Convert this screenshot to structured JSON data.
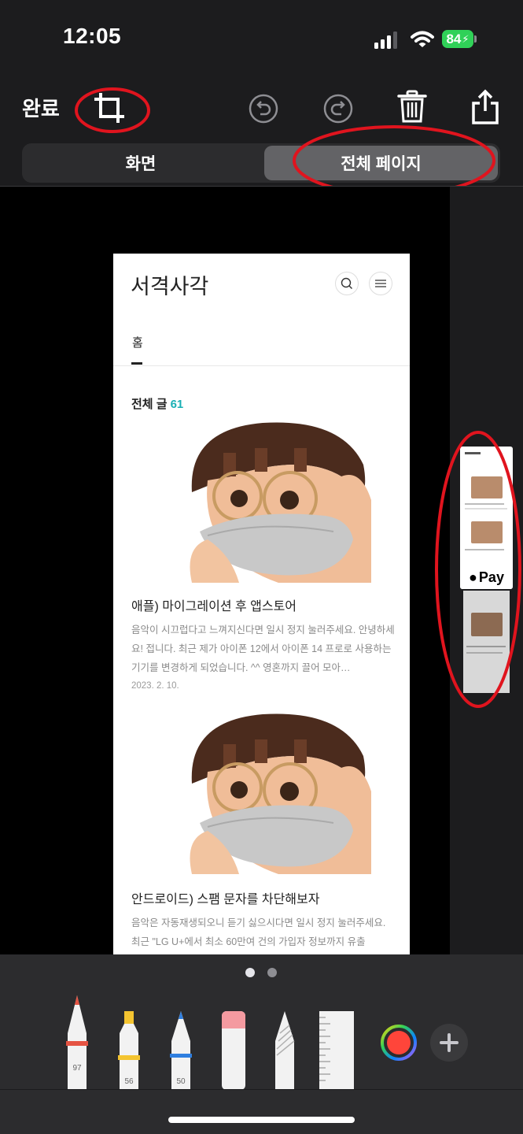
{
  "status_bar": {
    "time": "12:05",
    "battery": "84",
    "icons": [
      "cellular-signal-icon",
      "wifi-icon",
      "battery-charging-icon"
    ]
  },
  "toolbar": {
    "done_label": "완료",
    "icons": [
      "crop-icon",
      "undo-icon",
      "redo-icon",
      "trash-icon",
      "share-icon"
    ]
  },
  "segmented": {
    "screen_label": "화면",
    "full_page_label": "전체 페이지",
    "selected": "full_page"
  },
  "blog": {
    "title": "서격사각",
    "nav_home": "홈",
    "all_posts_label": "전체 글",
    "all_posts_count": "61",
    "posts": [
      {
        "title": "애플) 마이그레이션 후 앱스토어",
        "excerpt": "음악이 시끄럽다고 느껴지신다면 일시 정지 눌러주세요. 안녕하세요! 접니다. 최근 제가 아이폰 12에서 아이폰 14 프로로 사용하는 기기를 변경하게 되었습니다. ^^ 영혼까지 끌어 모아…",
        "date": "2023. 2. 10."
      },
      {
        "title": "안드로이드) 스팸 문자를 차단해보자",
        "excerpt": "음악은 자동재생되오니 듣기 싫으시다면 일시 정지 눌러주세요. 최근 \"LG U+에서 최소 60만여 건의 가입자 정보까지 유출"
      }
    ]
  },
  "thumbnail_strip": {
    "apple_pay_label": "Pay"
  },
  "markup_tools": {
    "pen_width": "97",
    "highlighter_width": "56",
    "pencil_width": "50",
    "tools": [
      "pen-tool-icon",
      "highlighter-tool-icon",
      "pencil-tool-icon",
      "eraser-tool-icon",
      "lasso-tool-icon",
      "ruler-tool-icon"
    ],
    "color_current": "#ff453a",
    "page_dots": 2,
    "active_dot": 0
  },
  "colors": {
    "accent_count": "#1ab0b5",
    "annotation_red": "#e0141e",
    "battery_green": "#30d158"
  }
}
